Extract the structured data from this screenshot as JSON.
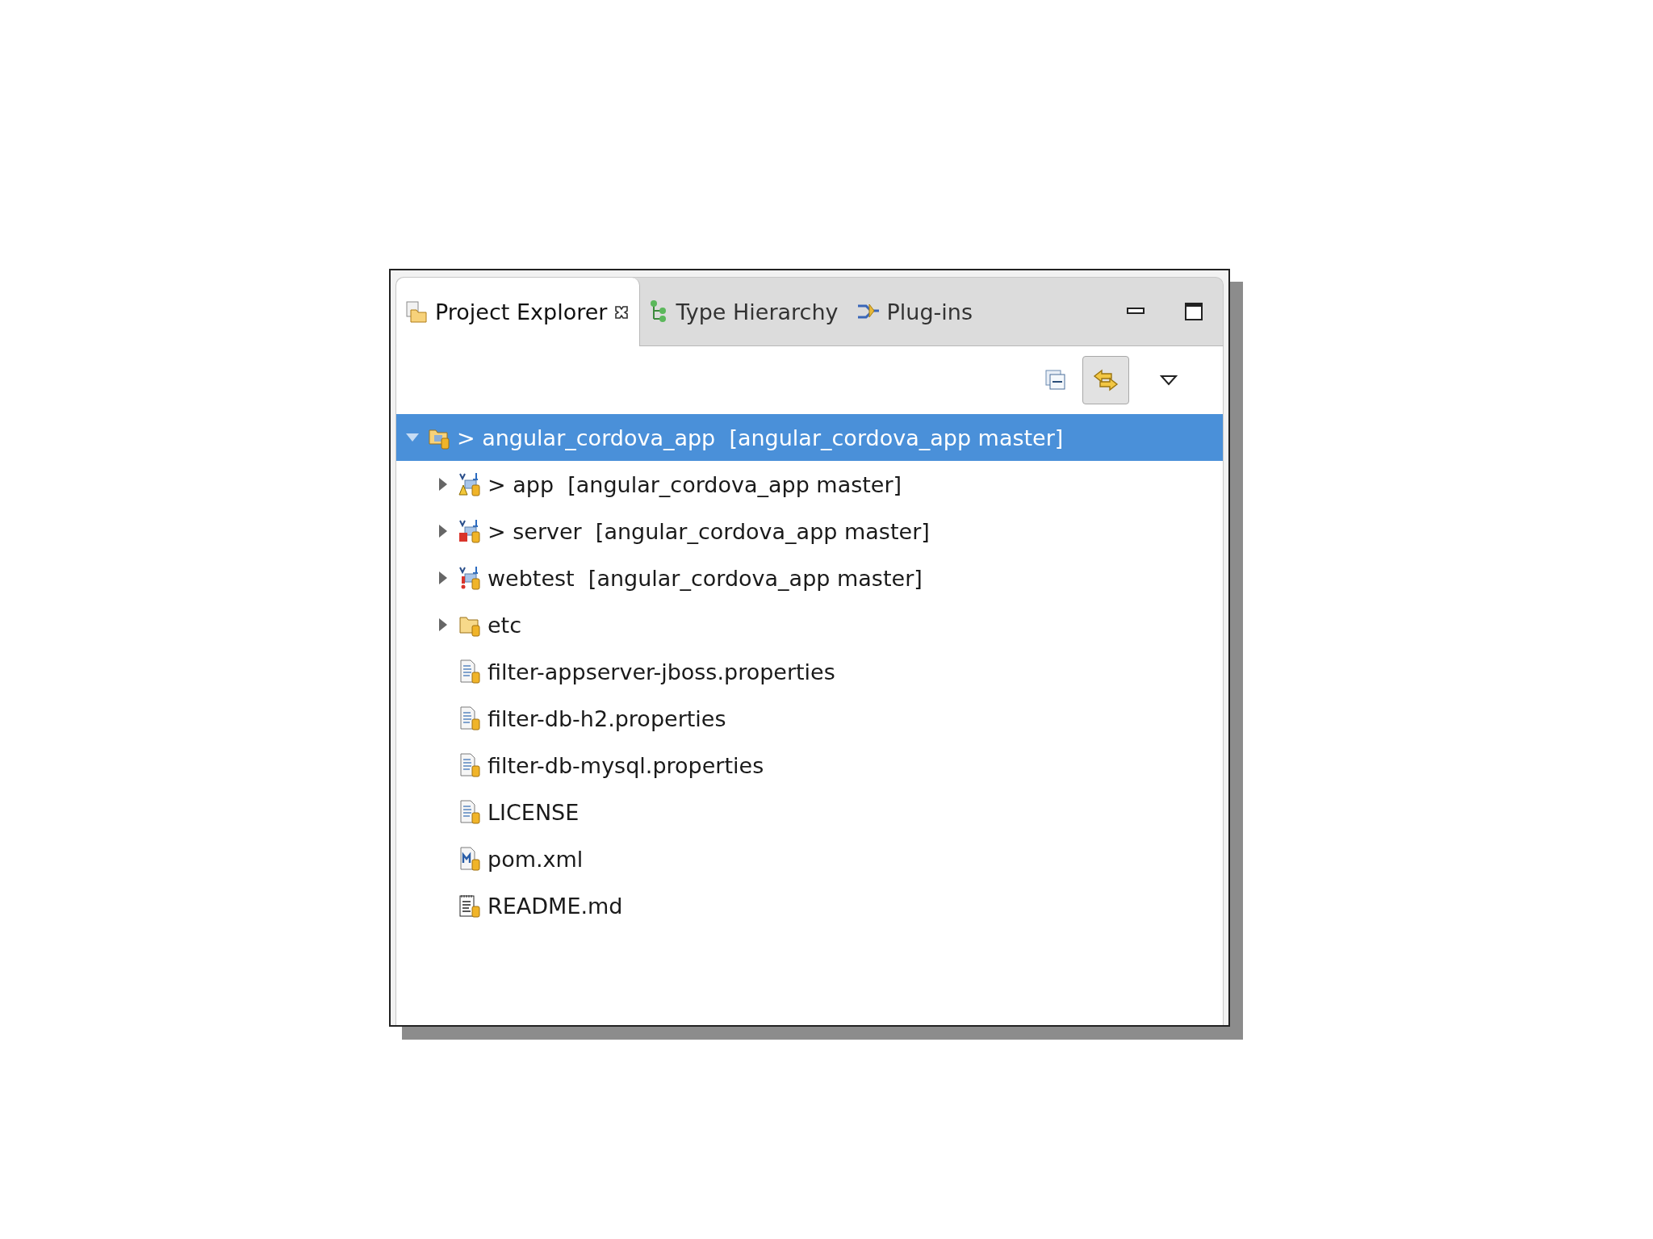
{
  "tabs": [
    {
      "label": "Project Explorer",
      "kind": "explorer",
      "selected": true,
      "closable": true
    },
    {
      "label": "Type Hierarchy",
      "kind": "hierarchy",
      "selected": false,
      "closable": false
    },
    {
      "label": "Plug-ins",
      "kind": "plugins",
      "selected": false,
      "closable": false
    }
  ],
  "toolbar": [
    {
      "kind": "collapse",
      "pressed": false
    },
    {
      "kind": "link",
      "pressed": true
    },
    {
      "kind": "menu",
      "pressed": false
    }
  ],
  "tree": [
    {
      "name": "> angular_cordova_app",
      "decoration": "[angular_cordova_app master]",
      "kind": "repo",
      "expanded": true,
      "selected": true,
      "children": [
        {
          "name": "> app",
          "decoration": "[angular_cordova_app master]",
          "kind": "project",
          "warning": true,
          "error": false,
          "alert": false,
          "expanded": false,
          "selected": false
        },
        {
          "name": "> server",
          "decoration": "[angular_cordova_app master]",
          "kind": "project",
          "warning": false,
          "error": true,
          "alert": false,
          "expanded": false,
          "selected": false
        },
        {
          "name": "webtest",
          "decoration": "[angular_cordova_app master]",
          "kind": "project",
          "warning": false,
          "error": false,
          "alert": true,
          "expanded": false,
          "selected": false
        },
        {
          "name": "etc",
          "kind": "folder",
          "expanded": false,
          "selected": false
        },
        {
          "name": "filter-appserver-jboss.properties",
          "kind": "textfile",
          "selected": false
        },
        {
          "name": "filter-db-h2.properties",
          "kind": "textfile",
          "selected": false
        },
        {
          "name": "filter-db-mysql.properties",
          "kind": "textfile",
          "selected": false
        },
        {
          "name": "LICENSE",
          "kind": "textfile",
          "selected": false
        },
        {
          "name": "pom.xml",
          "kind": "maven",
          "selected": false
        },
        {
          "name": "README.md",
          "kind": "readme",
          "selected": false
        }
      ]
    }
  ]
}
